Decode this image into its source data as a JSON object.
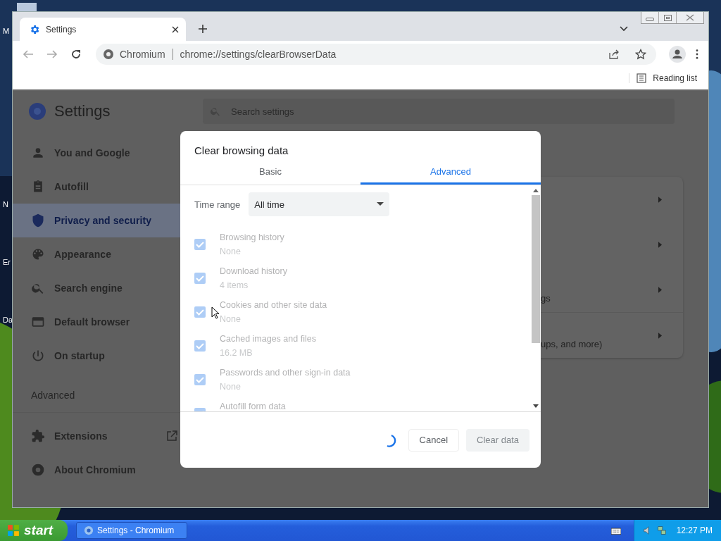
{
  "desktop": {
    "icon_labels": [
      "M",
      "N",
      "Er",
      "Da"
    ]
  },
  "browser": {
    "tabs": [
      {
        "title": "Settings",
        "selected": true
      }
    ],
    "address": {
      "site": "Chromium",
      "url": "chrome://settings/clearBrowserData"
    },
    "reading_list": "Reading list"
  },
  "settings": {
    "title": "Settings",
    "search_placeholder": "Search settings",
    "nav": [
      {
        "label": "You and Google",
        "selected": false
      },
      {
        "label": "Autofill",
        "selected": false
      },
      {
        "label": "Privacy and security",
        "selected": true
      },
      {
        "label": "Appearance",
        "selected": false
      },
      {
        "label": "Search engine",
        "selected": false
      },
      {
        "label": "Default browser",
        "selected": false
      },
      {
        "label": "On startup",
        "selected": false
      }
    ],
    "advanced": "Advanced",
    "extensions": "Extensions",
    "about": "About Chromium",
    "card_fragments": [
      "gs",
      "ups, and more)"
    ]
  },
  "dialog": {
    "title": "Clear browsing data",
    "tabs": [
      {
        "label": "Basic",
        "selected": false
      },
      {
        "label": "Advanced",
        "selected": true
      }
    ],
    "time_range": {
      "label": "Time range",
      "value": "All time"
    },
    "busy": true,
    "items": [
      {
        "title": "Browsing history",
        "detail": "None",
        "checked": true
      },
      {
        "title": "Download history",
        "detail": "4 items",
        "checked": true
      },
      {
        "title": "Cookies and other site data",
        "detail": "None",
        "checked": true
      },
      {
        "title": "Cached images and files",
        "detail": "16.2 MB",
        "checked": true
      },
      {
        "title": "Passwords and other sign-in data",
        "detail": "None",
        "checked": true
      },
      {
        "title": "Autofill form data",
        "checked": true
      }
    ],
    "cancel": "Cancel",
    "confirm": {
      "label": "Clear data",
      "disabled": true
    }
  },
  "taskbar": {
    "start": "start",
    "tasks": [
      {
        "label": "Settings - Chromium",
        "selected": false
      }
    ],
    "clock": "12:27 PM"
  }
}
